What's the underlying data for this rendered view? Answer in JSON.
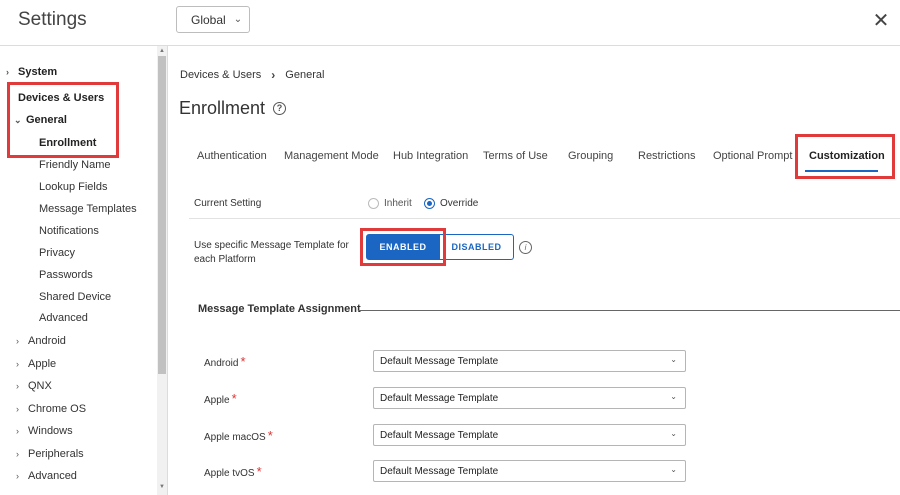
{
  "header": {
    "title": "Settings",
    "scope_label": "Global",
    "close_glyph": "✕"
  },
  "sidebar": {
    "items": [
      {
        "label": "System",
        "caret": "›"
      },
      {
        "label": "Devices & Users",
        "caret": "⌄"
      },
      {
        "label": "General",
        "caret": "⌄"
      },
      {
        "label": "Enrollment"
      },
      {
        "label": "Friendly Name"
      },
      {
        "label": "Lookup Fields"
      },
      {
        "label": "Message Templates"
      },
      {
        "label": "Notifications"
      },
      {
        "label": "Privacy"
      },
      {
        "label": "Passwords"
      },
      {
        "label": "Shared Device"
      },
      {
        "label": "Advanced"
      },
      {
        "label": "Android",
        "caret": "›"
      },
      {
        "label": "Apple",
        "caret": "›"
      },
      {
        "label": "QNX",
        "caret": "›"
      },
      {
        "label": "Chrome OS",
        "caret": "›"
      },
      {
        "label": "Windows",
        "caret": "›"
      },
      {
        "label": "Peripherals",
        "caret": "›"
      },
      {
        "label": "Advanced",
        "caret": "›"
      }
    ]
  },
  "breadcrumb": {
    "items": [
      "Devices & Users",
      "General"
    ],
    "separator": "›"
  },
  "page": {
    "title": "Enrollment",
    "help_glyph": "?"
  },
  "tabs": [
    {
      "label": "Authentication"
    },
    {
      "label": "Management Mode"
    },
    {
      "label": "Hub Integration"
    },
    {
      "label": "Terms of Use"
    },
    {
      "label": "Grouping"
    },
    {
      "label": "Restrictions"
    },
    {
      "label": "Optional Prompt"
    },
    {
      "label": "Customization",
      "active": true
    }
  ],
  "current_setting": {
    "label": "Current Setting",
    "options": [
      {
        "label": "Inherit",
        "checked": false
      },
      {
        "label": "Override",
        "checked": true
      }
    ]
  },
  "template_toggle": {
    "label": "Use specific Message Template for each Platform",
    "enabled_label": "ENABLED",
    "disabled_label": "DISABLED",
    "value": "ENABLED",
    "info_glyph": "i"
  },
  "assignment": {
    "section_title": "Message Template Assignment",
    "required_glyph": "*",
    "rows": [
      {
        "platform": "Android",
        "value": "Default Message Template"
      },
      {
        "platform": "Apple",
        "value": "Default Message Template"
      },
      {
        "platform": "Apple macOS",
        "value": "Default Message Template"
      },
      {
        "platform": "Apple tvOS",
        "value": "Default Message Template"
      }
    ]
  },
  "colors": {
    "accent": "#1a66c2",
    "highlight": "#e03a3a",
    "required": "#dd3333"
  }
}
